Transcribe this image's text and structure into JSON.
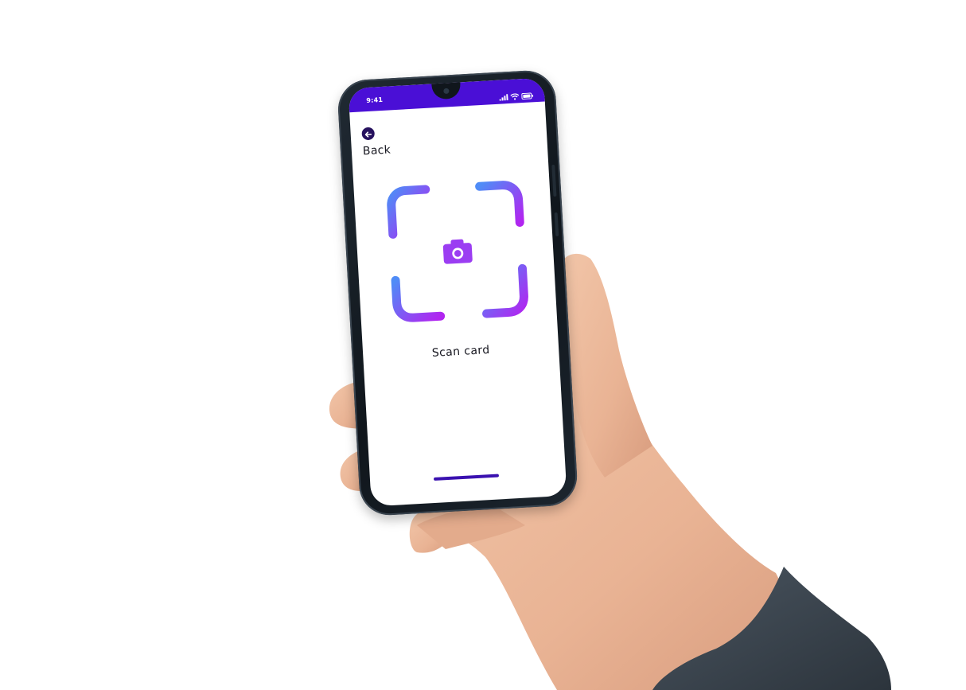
{
  "status_bar": {
    "time": "9:41",
    "signal_icon": "signal-bars-icon",
    "wifi_icon": "wifi-icon",
    "battery_icon": "battery-icon",
    "background": "#4a0fd6"
  },
  "header": {
    "back_icon": "arrow-left-icon",
    "back_label": "Back"
  },
  "scanner": {
    "icon": "camera-icon",
    "gradient_start": "#4f8cf7",
    "gradient_end": "#b125f0",
    "label": "Scan card"
  },
  "colors": {
    "accent": "#4a0fd6",
    "back_button": "#26115e",
    "home_indicator": "#3a11b0"
  }
}
